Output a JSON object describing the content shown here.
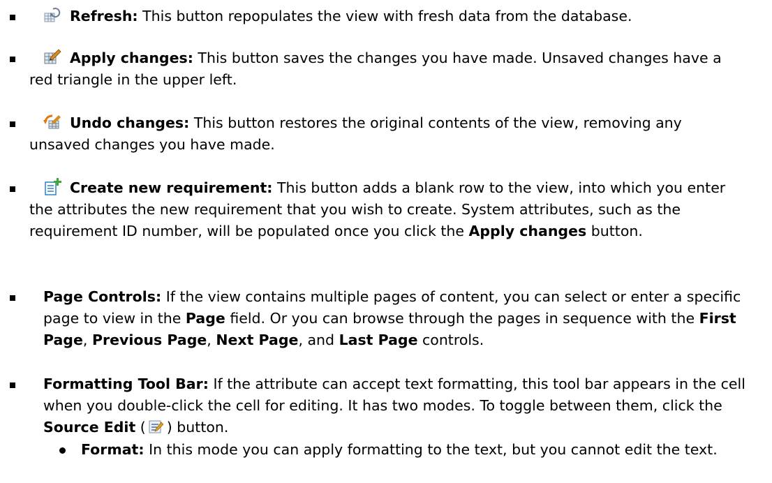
{
  "items": [
    {
      "icon": "refresh-icon",
      "label": "Refresh:",
      "text": " This button repopulates the view with fresh data from the database."
    },
    {
      "icon": "apply-changes-icon",
      "label": "Apply changes:",
      "text": " This button saves the changes you have made. Unsaved changes have a red triangle in the upper left."
    },
    {
      "icon": "undo-changes-icon",
      "label": "Undo changes:",
      "text": " This button restores the original contents of the view, removing any unsaved changes you have made."
    },
    {
      "icon": "create-requirement-icon",
      "label": "Create new requirement:",
      "text": " This button adds a blank row to the view, into which you enter the attributes the new requirement that you wish to create. System attributes, such as the requirement ID number, will be populated once you click the ",
      "bold2": "Apply changes",
      "text2": " button."
    },
    {
      "label": "Page Controls:",
      "text_a": " If the view contains multiple pages of content, you can select or enter a specific page to view in the ",
      "b_page": "Page",
      "text_b": " field. Or you can browse through the pages in sequence with the ",
      "b_first": "First Page",
      "c1": ", ",
      "b_prev": "Previous Page",
      "c2": ", ",
      "b_next": "Next Page",
      "c3": ", and ",
      "b_last": "Last Page",
      "text_c": " controls."
    },
    {
      "label": "Formatting Tool Bar:",
      "text_a": " If the attribute can accept text formatting, this tool bar appears in the cell when you double-click the cell for editing. It has two modes. To toggle between them, click the ",
      "b_source": "Source Edit",
      "paren_open": " (",
      "inline_icon": "source-edit-icon",
      "paren_close": ")",
      "text_b": " button."
    }
  ],
  "sub_items": [
    {
      "label": "Format:",
      "text": " In this mode you can apply formatting to the text, but you cannot edit the text."
    }
  ],
  "colors": {
    "text": "#000000",
    "background": "#ffffff"
  }
}
